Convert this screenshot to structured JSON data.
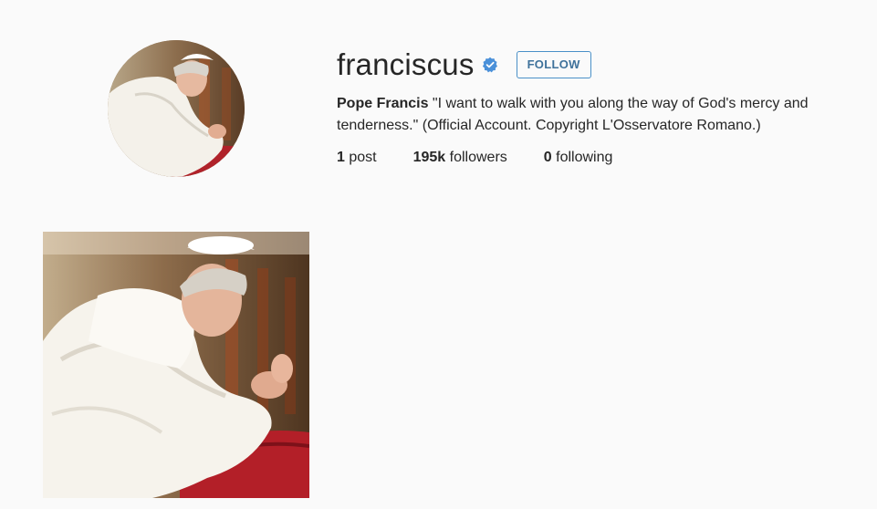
{
  "profile": {
    "username": "franciscus",
    "verified_icon": "verified-badge-icon",
    "follow_label": "FOLLOW",
    "full_name": "Pope Francis",
    "bio_text": " \"I want to walk with you along the way of God's mercy and tenderness.\" (Official Account. Copyright L'Osservatore Romano.)",
    "avatar_image": "profile-photo",
    "accent_color": "#3f729b",
    "verified_color": "#4a90d9"
  },
  "stats": {
    "posts_count": "1",
    "posts_label": " post",
    "followers_count": "195k",
    "followers_label": " followers",
    "following_count": "0",
    "following_label": " following"
  },
  "posts": [
    {
      "image": "praying-pope-photo"
    }
  ]
}
